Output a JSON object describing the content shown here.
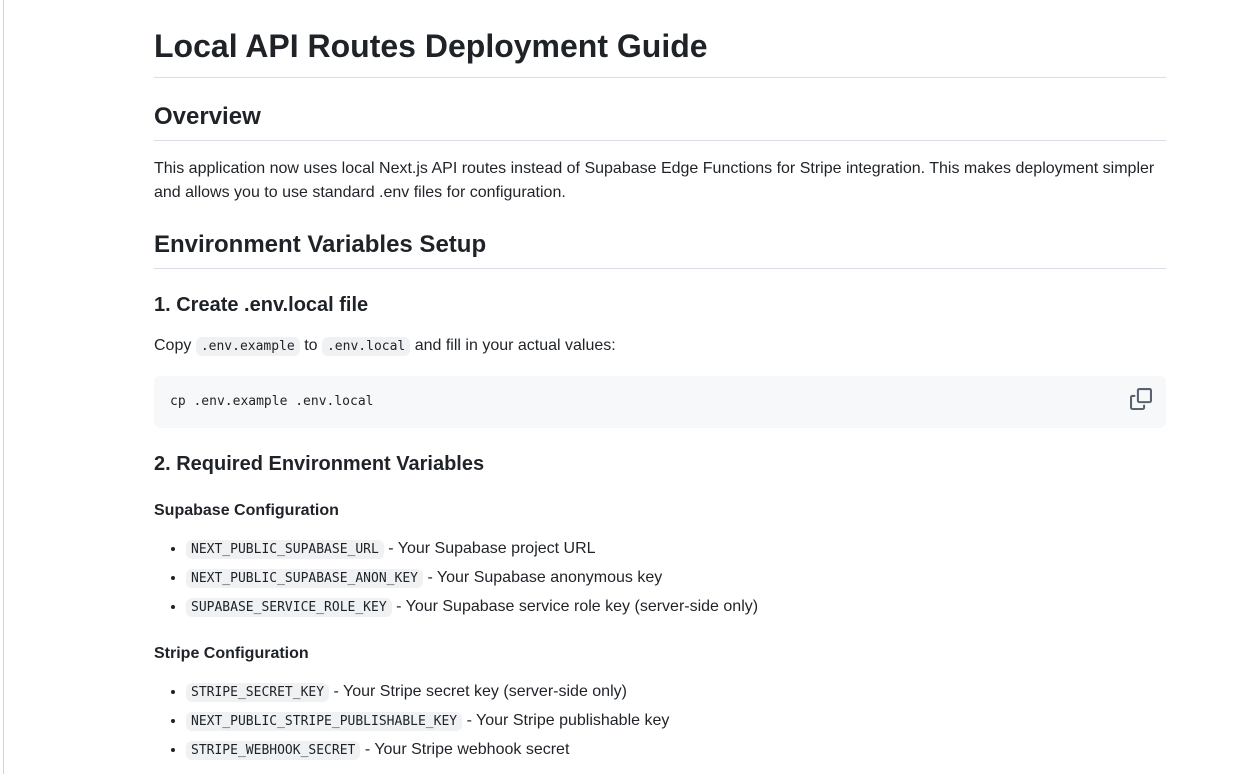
{
  "title": "Local API Routes Deployment Guide",
  "overview": {
    "heading": "Overview",
    "text": "This application now uses local Next.js API routes instead of Supabase Edge Functions for Stripe integration. This makes deployment simpler and allows you to use standard .env files for configuration."
  },
  "env_setup": {
    "heading": "Environment Variables Setup",
    "create": {
      "heading": "1. Create .env.local file",
      "prefix": "Copy",
      "source_file": ".env.example",
      "middle": "to",
      "target_file": ".env.local",
      "suffix": "and fill in your actual values:",
      "command": "cp .env.example .env.local",
      "copy_icon": "copy-icon"
    },
    "required": {
      "heading": "2. Required Environment Variables",
      "supabase": {
        "heading": "Supabase Configuration",
        "items": [
          {
            "code": "NEXT_PUBLIC_SUPABASE_URL",
            "desc": "- Your Supabase project URL"
          },
          {
            "code": "NEXT_PUBLIC_SUPABASE_ANON_KEY",
            "desc": "- Your Supabase anonymous key"
          },
          {
            "code": "SUPABASE_SERVICE_ROLE_KEY",
            "desc": "- Your Supabase service role key (server-side only)"
          }
        ]
      },
      "stripe": {
        "heading": "Stripe Configuration",
        "items": [
          {
            "code": "STRIPE_SECRET_KEY",
            "desc": "- Your Stripe secret key (server-side only)"
          },
          {
            "code": "NEXT_PUBLIC_STRIPE_PUBLISHABLE_KEY",
            "desc": "- Your Stripe publishable key"
          },
          {
            "code": "STRIPE_WEBHOOK_SECRET",
            "desc": "- Your Stripe webhook secret"
          }
        ]
      }
    }
  }
}
